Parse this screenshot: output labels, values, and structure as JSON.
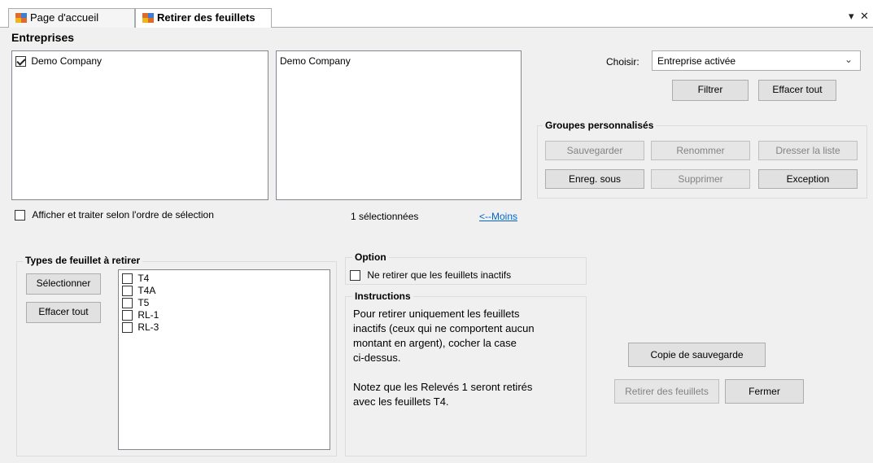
{
  "tabs": [
    {
      "label": "Page d'accueil"
    },
    {
      "label": "Retirer des feuillets"
    }
  ],
  "window_controls": {
    "pin": "▾",
    "close": "✕"
  },
  "companies": {
    "title": "Entreprises",
    "available": [
      {
        "label": "Demo Company",
        "checked": true
      }
    ],
    "selected": [
      {
        "label": "Demo Company"
      }
    ],
    "order_checkbox_label": "Afficher et traiter selon l'ordre de sélection",
    "selected_count": "1 sélectionnées",
    "less_link": "<--Moins"
  },
  "filter": {
    "choose_label": "Choisir:",
    "choose_value": "Entreprise activée",
    "filter_button": "Filtrer",
    "clear_all_button": "Effacer tout"
  },
  "custom_groups": {
    "title": "Groupes personnalisés",
    "save": "Sauvegarder",
    "rename": "Renommer",
    "list": "Dresser la liste",
    "save_as": "Enreg. sous",
    "delete": "Supprimer",
    "exception": "Exception"
  },
  "slip_types": {
    "title": "Types de feuillet à retirer",
    "select_button": "Sélectionner",
    "clear_button": "Effacer tout",
    "items": [
      {
        "label": "T4",
        "checked": false
      },
      {
        "label": "T4A",
        "checked": false
      },
      {
        "label": "T5",
        "checked": false
      },
      {
        "label": "RL-1",
        "checked": false
      },
      {
        "label": "RL-3",
        "checked": false
      }
    ]
  },
  "option": {
    "title": "Option",
    "inactive_only_label": "Ne retirer que les feuillets inactifs"
  },
  "instructions": {
    "title": "Instructions",
    "lines": [
      "Pour retirer uniquement les feuillets",
      "inactifs (ceux qui ne comportent aucun",
      "montant en argent), cocher la case",
      "ci-dessus.",
      "",
      "Notez que les Relevés 1 seront retirés",
      "avec les feuillets T4."
    ]
  },
  "actions": {
    "backup_button": "Copie de sauvegarde",
    "remove_button": "Retirer des feuillets",
    "close_button": "Fermer"
  }
}
